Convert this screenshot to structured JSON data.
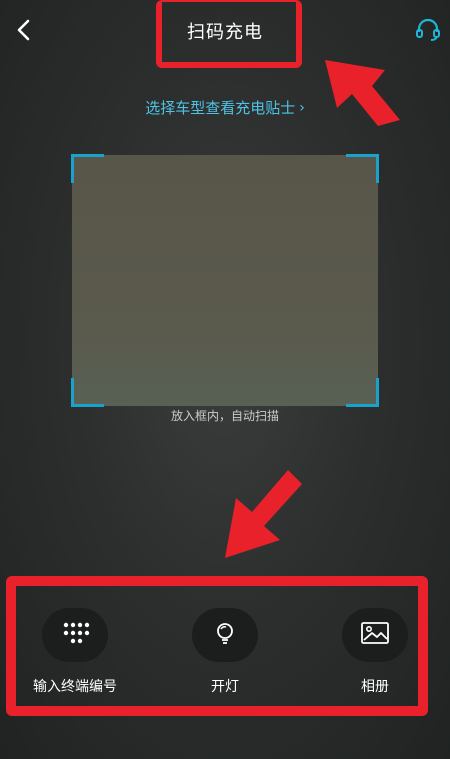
{
  "header": {
    "title": "扫码充电",
    "back_icon": "chevron-left-icon",
    "support_icon": "headset-icon"
  },
  "tips": {
    "label": "选择车型查看充电贴士",
    "chevron": "›"
  },
  "scanner": {
    "hint": "放入框内，自动扫描"
  },
  "actions": [
    {
      "label": "输入终端编号",
      "icon": "keypad-icon"
    },
    {
      "label": "开灯",
      "icon": "flashlight-icon"
    },
    {
      "label": "相册",
      "icon": "photo-album-icon"
    }
  ],
  "colors": {
    "accent": "#1aa2cc",
    "link": "#4fc3e6",
    "annotation_red": "#e8212b"
  }
}
